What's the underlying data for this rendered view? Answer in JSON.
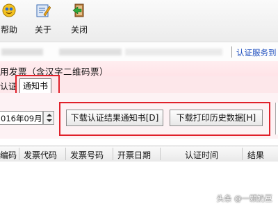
{
  "toolbar": {
    "help_label": "帮助",
    "about_label": "关于",
    "close_label": "关闭"
  },
  "address_bar": {
    "service_link": "认证服务到"
  },
  "subtitle": "用发票（含汉字二维码票）",
  "tabs": [
    {
      "label": "认证"
    },
    {
      "label": "通知书"
    }
  ],
  "controls": {
    "month_value": "016年09月",
    "download_notice_button": "下载认证结果通知书[D]",
    "download_history_button": "下载打印历史数据[H]"
  },
  "table": {
    "columns": [
      "编码",
      "发票代码",
      "发票号码",
      "开票日期",
      "认证时间",
      "结果"
    ]
  },
  "watermark": "头条 @一颗奶豆",
  "colors": {
    "highlight_box": "#e0202a",
    "link": "#1f4fbf",
    "pink_band": "#ffe3e7"
  }
}
